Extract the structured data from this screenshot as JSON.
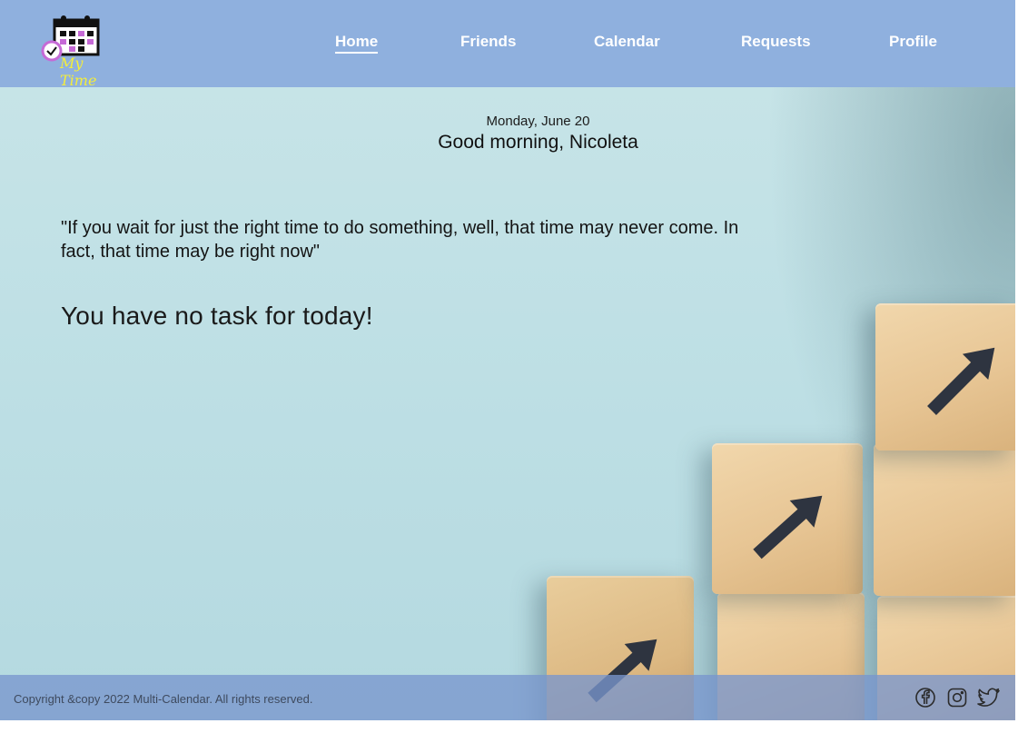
{
  "app": {
    "logo_text": "My Time",
    "logo_text_color": "#f4ee3a"
  },
  "colors": {
    "header": "#8fb0de",
    "footer": "#7896cd",
    "arrow": "#2e3440"
  },
  "nav": {
    "items": [
      {
        "label": "Home",
        "active": true
      },
      {
        "label": "Friends",
        "active": false
      },
      {
        "label": "Calendar",
        "active": false
      },
      {
        "label": "Requests",
        "active": false
      },
      {
        "label": "Profile",
        "active": false
      }
    ]
  },
  "main": {
    "date": "Monday, June 20",
    "greeting": "Good morning, Nicoleta",
    "quote": "\"If you wait for just the right time to do something, well, that time may never come. In fact, that time may be right now\"",
    "no_task_message": "You have no task for today!"
  },
  "footer": {
    "copyright": "Copyright &copy 2022 Multi-Calendar. All rights reserved.",
    "social": [
      "facebook-icon",
      "instagram-icon",
      "twitter-icon"
    ]
  }
}
